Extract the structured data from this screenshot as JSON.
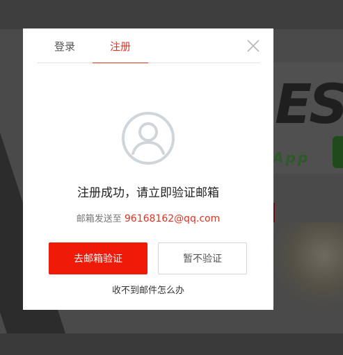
{
  "background": {
    "logo_text": "ES",
    "logo_app": "App"
  },
  "dialog": {
    "tabs": [
      {
        "label": "登录",
        "active": false
      },
      {
        "label": "注册",
        "active": true
      }
    ],
    "close_icon": "close-icon",
    "avatar_icon": "user-avatar-icon",
    "title": "注册成功，请立即验证邮箱",
    "sent_prefix": "邮箱发送至 ",
    "email": "96168162@qq.com",
    "primary_button": "去邮箱验证",
    "secondary_button": "暂不验证",
    "help_link": "收不到邮件怎么办"
  },
  "colors": {
    "accent": "#e5301e",
    "primary_button": "#f01a09",
    "overlay": "#4a4a4a"
  }
}
